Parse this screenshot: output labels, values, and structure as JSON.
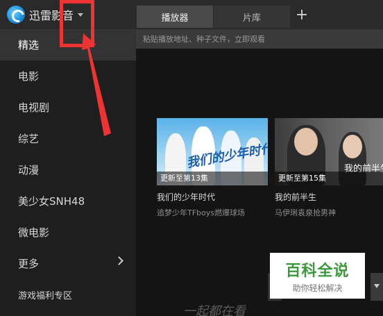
{
  "app": {
    "title": "迅雷影音"
  },
  "tabs": [
    {
      "label": "播放器",
      "active": true
    },
    {
      "label": "片库",
      "active": false
    }
  ],
  "new_tab_icon": "plus-icon",
  "address_bar": {
    "placeholder": "粘贴播放地址、种子文件，立即观看",
    "value": ""
  },
  "sidebar": {
    "items": [
      {
        "label": "精选",
        "active": true
      },
      {
        "label": "电影"
      },
      {
        "label": "电视剧"
      },
      {
        "label": "综艺"
      },
      {
        "label": "动漫"
      },
      {
        "label": "美少女SNH48"
      },
      {
        "label": "微电影"
      },
      {
        "label": "更多",
        "has_chevron": true
      },
      {
        "label": "游戏福利专区"
      }
    ]
  },
  "cards": [
    {
      "badge": "更新至第13集",
      "title": "我们的少年时代",
      "subtitle": "追梦少年TFboys燃爆球场",
      "thumb_text": "我们的少年时代"
    },
    {
      "badge": "更新至第15集",
      "title": "我的前半生",
      "subtitle": "马伊琍袁泉抢男神",
      "thumb_text": "我的前半生"
    }
  ],
  "footer_text": "一起都在看",
  "watermark": {
    "main": "百科全说",
    "sub": "助你轻松解决"
  },
  "colors": {
    "annotation_red": "#ee3333",
    "watermark_green": "#3a9a3a"
  }
}
